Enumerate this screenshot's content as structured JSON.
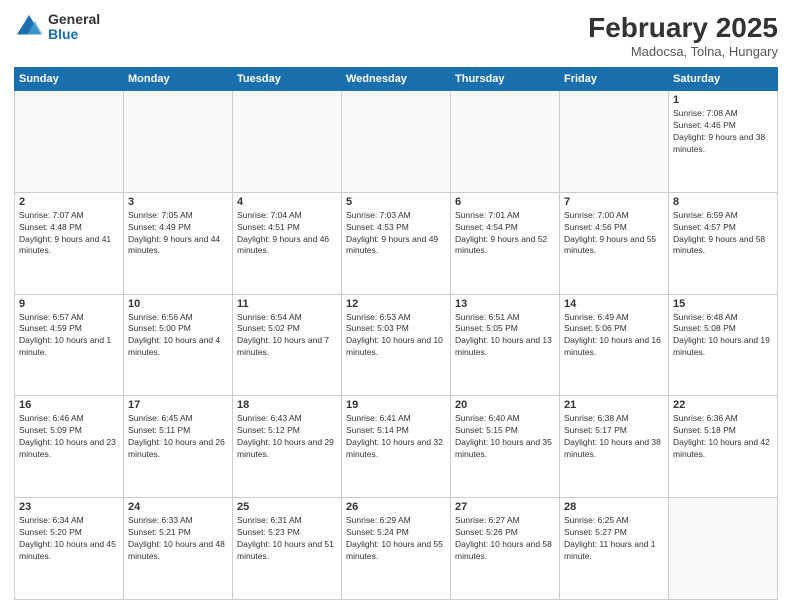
{
  "logo": {
    "general": "General",
    "blue": "Blue"
  },
  "title": "February 2025",
  "subtitle": "Madocsa, Tolna, Hungary",
  "header_days": [
    "Sunday",
    "Monday",
    "Tuesday",
    "Wednesday",
    "Thursday",
    "Friday",
    "Saturday"
  ],
  "weeks": [
    [
      {
        "day": "",
        "info": ""
      },
      {
        "day": "",
        "info": ""
      },
      {
        "day": "",
        "info": ""
      },
      {
        "day": "",
        "info": ""
      },
      {
        "day": "",
        "info": ""
      },
      {
        "day": "",
        "info": ""
      },
      {
        "day": "1",
        "info": "Sunrise: 7:08 AM\nSunset: 4:46 PM\nDaylight: 9 hours and 38 minutes."
      }
    ],
    [
      {
        "day": "2",
        "info": "Sunrise: 7:07 AM\nSunset: 4:48 PM\nDaylight: 9 hours and 41 minutes."
      },
      {
        "day": "3",
        "info": "Sunrise: 7:05 AM\nSunset: 4:49 PM\nDaylight: 9 hours and 44 minutes."
      },
      {
        "day": "4",
        "info": "Sunrise: 7:04 AM\nSunset: 4:51 PM\nDaylight: 9 hours and 46 minutes."
      },
      {
        "day": "5",
        "info": "Sunrise: 7:03 AM\nSunset: 4:53 PM\nDaylight: 9 hours and 49 minutes."
      },
      {
        "day": "6",
        "info": "Sunrise: 7:01 AM\nSunset: 4:54 PM\nDaylight: 9 hours and 52 minutes."
      },
      {
        "day": "7",
        "info": "Sunrise: 7:00 AM\nSunset: 4:56 PM\nDaylight: 9 hours and 55 minutes."
      },
      {
        "day": "8",
        "info": "Sunrise: 6:59 AM\nSunset: 4:57 PM\nDaylight: 9 hours and 58 minutes."
      }
    ],
    [
      {
        "day": "9",
        "info": "Sunrise: 6:57 AM\nSunset: 4:59 PM\nDaylight: 10 hours and 1 minute."
      },
      {
        "day": "10",
        "info": "Sunrise: 6:56 AM\nSunset: 5:00 PM\nDaylight: 10 hours and 4 minutes."
      },
      {
        "day": "11",
        "info": "Sunrise: 6:54 AM\nSunset: 5:02 PM\nDaylight: 10 hours and 7 minutes."
      },
      {
        "day": "12",
        "info": "Sunrise: 6:53 AM\nSunset: 5:03 PM\nDaylight: 10 hours and 10 minutes."
      },
      {
        "day": "13",
        "info": "Sunrise: 6:51 AM\nSunset: 5:05 PM\nDaylight: 10 hours and 13 minutes."
      },
      {
        "day": "14",
        "info": "Sunrise: 6:49 AM\nSunset: 5:06 PM\nDaylight: 10 hours and 16 minutes."
      },
      {
        "day": "15",
        "info": "Sunrise: 6:48 AM\nSunset: 5:08 PM\nDaylight: 10 hours and 19 minutes."
      }
    ],
    [
      {
        "day": "16",
        "info": "Sunrise: 6:46 AM\nSunset: 5:09 PM\nDaylight: 10 hours and 23 minutes."
      },
      {
        "day": "17",
        "info": "Sunrise: 6:45 AM\nSunset: 5:11 PM\nDaylight: 10 hours and 26 minutes."
      },
      {
        "day": "18",
        "info": "Sunrise: 6:43 AM\nSunset: 5:12 PM\nDaylight: 10 hours and 29 minutes."
      },
      {
        "day": "19",
        "info": "Sunrise: 6:41 AM\nSunset: 5:14 PM\nDaylight: 10 hours and 32 minutes."
      },
      {
        "day": "20",
        "info": "Sunrise: 6:40 AM\nSunset: 5:15 PM\nDaylight: 10 hours and 35 minutes."
      },
      {
        "day": "21",
        "info": "Sunrise: 6:38 AM\nSunset: 5:17 PM\nDaylight: 10 hours and 38 minutes."
      },
      {
        "day": "22",
        "info": "Sunrise: 6:36 AM\nSunset: 5:18 PM\nDaylight: 10 hours and 42 minutes."
      }
    ],
    [
      {
        "day": "23",
        "info": "Sunrise: 6:34 AM\nSunset: 5:20 PM\nDaylight: 10 hours and 45 minutes."
      },
      {
        "day": "24",
        "info": "Sunrise: 6:33 AM\nSunset: 5:21 PM\nDaylight: 10 hours and 48 minutes."
      },
      {
        "day": "25",
        "info": "Sunrise: 6:31 AM\nSunset: 5:23 PM\nDaylight: 10 hours and 51 minutes."
      },
      {
        "day": "26",
        "info": "Sunrise: 6:29 AM\nSunset: 5:24 PM\nDaylight: 10 hours and 55 minutes."
      },
      {
        "day": "27",
        "info": "Sunrise: 6:27 AM\nSunset: 5:26 PM\nDaylight: 10 hours and 58 minutes."
      },
      {
        "day": "28",
        "info": "Sunrise: 6:25 AM\nSunset: 5:27 PM\nDaylight: 11 hours and 1 minute."
      },
      {
        "day": "",
        "info": ""
      }
    ]
  ]
}
